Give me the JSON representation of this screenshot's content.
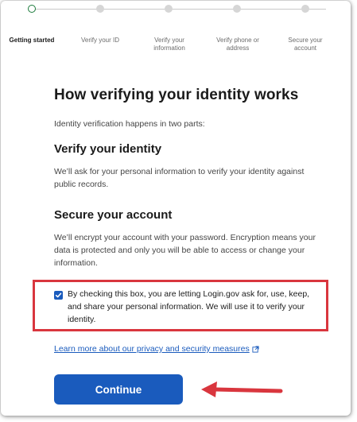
{
  "steps": [
    {
      "label": "Getting started",
      "status": "current"
    },
    {
      "label": "Verify your ID",
      "status": "pending"
    },
    {
      "label": "Verify your information",
      "status": "pending"
    },
    {
      "label": "Verify phone or address",
      "status": "pending"
    },
    {
      "label": "Secure your account",
      "status": "pending"
    }
  ],
  "main": {
    "title": "How verifying your identity works",
    "intro": "Identity verification happens in two parts:",
    "section1": {
      "heading": "Verify your identity",
      "body": "We’ll ask for your personal information to verify your identity against public records."
    },
    "section2": {
      "heading": "Secure your account",
      "body": "We’ll encrypt your account with your password. Encryption means your data is protected and only you will be able to access or change your information."
    },
    "consent": {
      "checked": true,
      "text": "By checking this box, you are letting Login.gov ask for, use, keep, and share your personal information. We will use it to verify your identity."
    },
    "privacy_link": "Learn more about our privacy and security measures",
    "continue_label": "Continue"
  },
  "colors": {
    "primary": "#1a5bbd",
    "highlight_box": "#d9363e",
    "current_step": "#1a7a3a",
    "arrow": "#d9363e"
  },
  "icons": {
    "checkbox": "check-icon",
    "external_link": "external-link-icon",
    "annotation": "arrow-left-icon"
  }
}
